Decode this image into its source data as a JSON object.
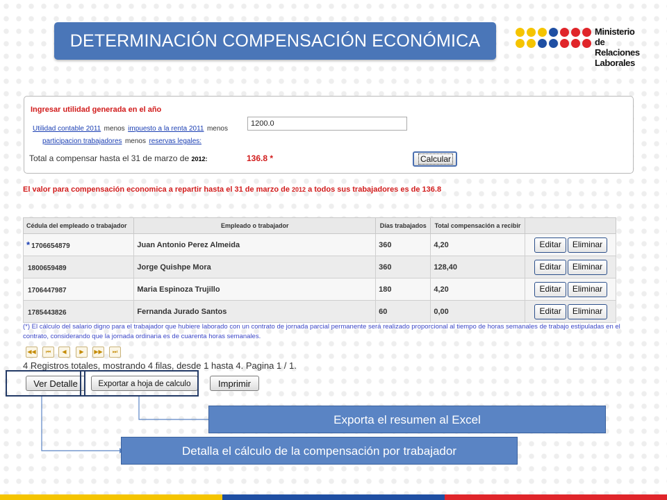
{
  "header": {
    "title": "DETERMINACIÓN COMPENSACIÓN ECONÓMICA"
  },
  "logo": {
    "line1": "Ministerio",
    "line2": "de Relaciones",
    "line3": "Laborales",
    "dot_colors": [
      "#f5c400",
      "#f5c400",
      "#f5c400",
      "#1f4fa3",
      "#1f4fa3",
      "#e0252a",
      "#e0252a",
      "#e0252a"
    ]
  },
  "input_panel": {
    "title": "Ingresar utilidad generada en el año",
    "link_utilidad": "Utilidad contable 2011",
    "text_menos_1": "menos",
    "link_impuesto": "impuesto a la renta 2011",
    "text_menos_2": "menos",
    "link_participacion": "participacion trabajadores",
    "text_menos_3": "menos",
    "link_reservas": "reservas legales:",
    "input_value": "1200.0",
    "total_label": "Total a compensar hasta el 31 de marzo de",
    "total_year": "2012:",
    "total_value": "136.8 *",
    "calc_button": "Calcular"
  },
  "notice": {
    "prefix": "El valor para compensación economica a repartir hasta el 31 de marzo de",
    "year": "2012",
    "suffix": "a todos sus trabajadores es de 136.8"
  },
  "table": {
    "headers": [
      "Cédula del empleado o trabajador",
      "Empleado o trabajador",
      "Días trabajados",
      "Total compensación a recibir",
      ""
    ],
    "rows": [
      {
        "marker": "*",
        "cedula": "1706654879",
        "nombre": "Juan Antonio Perez Almeida",
        "dias": "360",
        "total": "4,20"
      },
      {
        "marker": "",
        "cedula": "1800659489",
        "nombre": "Jorge Quishpe Mora",
        "dias": "360",
        "total": "128,40"
      },
      {
        "marker": "",
        "cedula": "1706447987",
        "nombre": "Maria Espinoza Trujillo",
        "dias": "180",
        "total": "4,20"
      },
      {
        "marker": "",
        "cedula": "1785443826",
        "nombre": "Fernanda Jurado Santos",
        "dias": "60",
        "total": "0,00"
      }
    ],
    "edit_label": "Editar",
    "delete_label": "Eliminar"
  },
  "footnote": "(*) El cálculo del salario digno para el trabajador que hubiere laborado con un contrato de jornada parcial permanente será realizado proporcional al tiempo de horas semanales de trabajo estipuladas en el contrato, considerando que la jornada ordinaria es de cuarenta horas semanales.",
  "pager": {
    "summary": "4 Registros totales, mostrando 4 filas, desde 1 hasta 4. Pagina 1 / 1."
  },
  "actions": {
    "ver_detalle": "Ver Detalle",
    "exportar": "Exportar a hoja de calculo",
    "imprimir": "Imprimir"
  },
  "callouts": {
    "export": "Exporta el resumen al Excel",
    "detalle": "Detalla el cálculo de la compensación por trabajador"
  },
  "colors": {
    "banner": "#4a76b8",
    "callout": "#5a84c4",
    "alert_red": "#d11b1b",
    "link_blue": "#1b3fb3"
  }
}
